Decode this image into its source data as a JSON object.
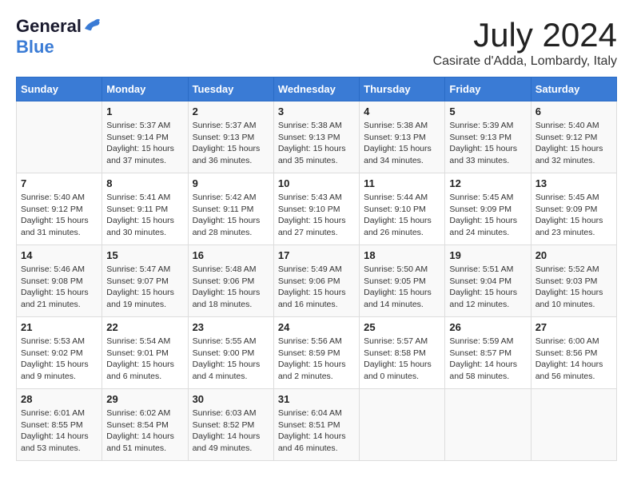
{
  "header": {
    "logo_general": "General",
    "logo_blue": "Blue",
    "month_title": "July 2024",
    "location": "Casirate d'Adda, Lombardy, Italy"
  },
  "weekdays": [
    "Sunday",
    "Monday",
    "Tuesday",
    "Wednesday",
    "Thursday",
    "Friday",
    "Saturday"
  ],
  "weeks": [
    [
      {
        "day": "",
        "info": ""
      },
      {
        "day": "1",
        "info": "Sunrise: 5:37 AM\nSunset: 9:14 PM\nDaylight: 15 hours\nand 37 minutes."
      },
      {
        "day": "2",
        "info": "Sunrise: 5:37 AM\nSunset: 9:13 PM\nDaylight: 15 hours\nand 36 minutes."
      },
      {
        "day": "3",
        "info": "Sunrise: 5:38 AM\nSunset: 9:13 PM\nDaylight: 15 hours\nand 35 minutes."
      },
      {
        "day": "4",
        "info": "Sunrise: 5:38 AM\nSunset: 9:13 PM\nDaylight: 15 hours\nand 34 minutes."
      },
      {
        "day": "5",
        "info": "Sunrise: 5:39 AM\nSunset: 9:13 PM\nDaylight: 15 hours\nand 33 minutes."
      },
      {
        "day": "6",
        "info": "Sunrise: 5:40 AM\nSunset: 9:12 PM\nDaylight: 15 hours\nand 32 minutes."
      }
    ],
    [
      {
        "day": "7",
        "info": "Sunrise: 5:40 AM\nSunset: 9:12 PM\nDaylight: 15 hours\nand 31 minutes."
      },
      {
        "day": "8",
        "info": "Sunrise: 5:41 AM\nSunset: 9:11 PM\nDaylight: 15 hours\nand 30 minutes."
      },
      {
        "day": "9",
        "info": "Sunrise: 5:42 AM\nSunset: 9:11 PM\nDaylight: 15 hours\nand 28 minutes."
      },
      {
        "day": "10",
        "info": "Sunrise: 5:43 AM\nSunset: 9:10 PM\nDaylight: 15 hours\nand 27 minutes."
      },
      {
        "day": "11",
        "info": "Sunrise: 5:44 AM\nSunset: 9:10 PM\nDaylight: 15 hours\nand 26 minutes."
      },
      {
        "day": "12",
        "info": "Sunrise: 5:45 AM\nSunset: 9:09 PM\nDaylight: 15 hours\nand 24 minutes."
      },
      {
        "day": "13",
        "info": "Sunrise: 5:45 AM\nSunset: 9:09 PM\nDaylight: 15 hours\nand 23 minutes."
      }
    ],
    [
      {
        "day": "14",
        "info": "Sunrise: 5:46 AM\nSunset: 9:08 PM\nDaylight: 15 hours\nand 21 minutes."
      },
      {
        "day": "15",
        "info": "Sunrise: 5:47 AM\nSunset: 9:07 PM\nDaylight: 15 hours\nand 19 minutes."
      },
      {
        "day": "16",
        "info": "Sunrise: 5:48 AM\nSunset: 9:06 PM\nDaylight: 15 hours\nand 18 minutes."
      },
      {
        "day": "17",
        "info": "Sunrise: 5:49 AM\nSunset: 9:06 PM\nDaylight: 15 hours\nand 16 minutes."
      },
      {
        "day": "18",
        "info": "Sunrise: 5:50 AM\nSunset: 9:05 PM\nDaylight: 15 hours\nand 14 minutes."
      },
      {
        "day": "19",
        "info": "Sunrise: 5:51 AM\nSunset: 9:04 PM\nDaylight: 15 hours\nand 12 minutes."
      },
      {
        "day": "20",
        "info": "Sunrise: 5:52 AM\nSunset: 9:03 PM\nDaylight: 15 hours\nand 10 minutes."
      }
    ],
    [
      {
        "day": "21",
        "info": "Sunrise: 5:53 AM\nSunset: 9:02 PM\nDaylight: 15 hours\nand 9 minutes."
      },
      {
        "day": "22",
        "info": "Sunrise: 5:54 AM\nSunset: 9:01 PM\nDaylight: 15 hours\nand 6 minutes."
      },
      {
        "day": "23",
        "info": "Sunrise: 5:55 AM\nSunset: 9:00 PM\nDaylight: 15 hours\nand 4 minutes."
      },
      {
        "day": "24",
        "info": "Sunrise: 5:56 AM\nSunset: 8:59 PM\nDaylight: 15 hours\nand 2 minutes."
      },
      {
        "day": "25",
        "info": "Sunrise: 5:57 AM\nSunset: 8:58 PM\nDaylight: 15 hours\nand 0 minutes."
      },
      {
        "day": "26",
        "info": "Sunrise: 5:59 AM\nSunset: 8:57 PM\nDaylight: 14 hours\nand 58 minutes."
      },
      {
        "day": "27",
        "info": "Sunrise: 6:00 AM\nSunset: 8:56 PM\nDaylight: 14 hours\nand 56 minutes."
      }
    ],
    [
      {
        "day": "28",
        "info": "Sunrise: 6:01 AM\nSunset: 8:55 PM\nDaylight: 14 hours\nand 53 minutes."
      },
      {
        "day": "29",
        "info": "Sunrise: 6:02 AM\nSunset: 8:54 PM\nDaylight: 14 hours\nand 51 minutes."
      },
      {
        "day": "30",
        "info": "Sunrise: 6:03 AM\nSunset: 8:52 PM\nDaylight: 14 hours\nand 49 minutes."
      },
      {
        "day": "31",
        "info": "Sunrise: 6:04 AM\nSunset: 8:51 PM\nDaylight: 14 hours\nand 46 minutes."
      },
      {
        "day": "",
        "info": ""
      },
      {
        "day": "",
        "info": ""
      },
      {
        "day": "",
        "info": ""
      }
    ]
  ]
}
